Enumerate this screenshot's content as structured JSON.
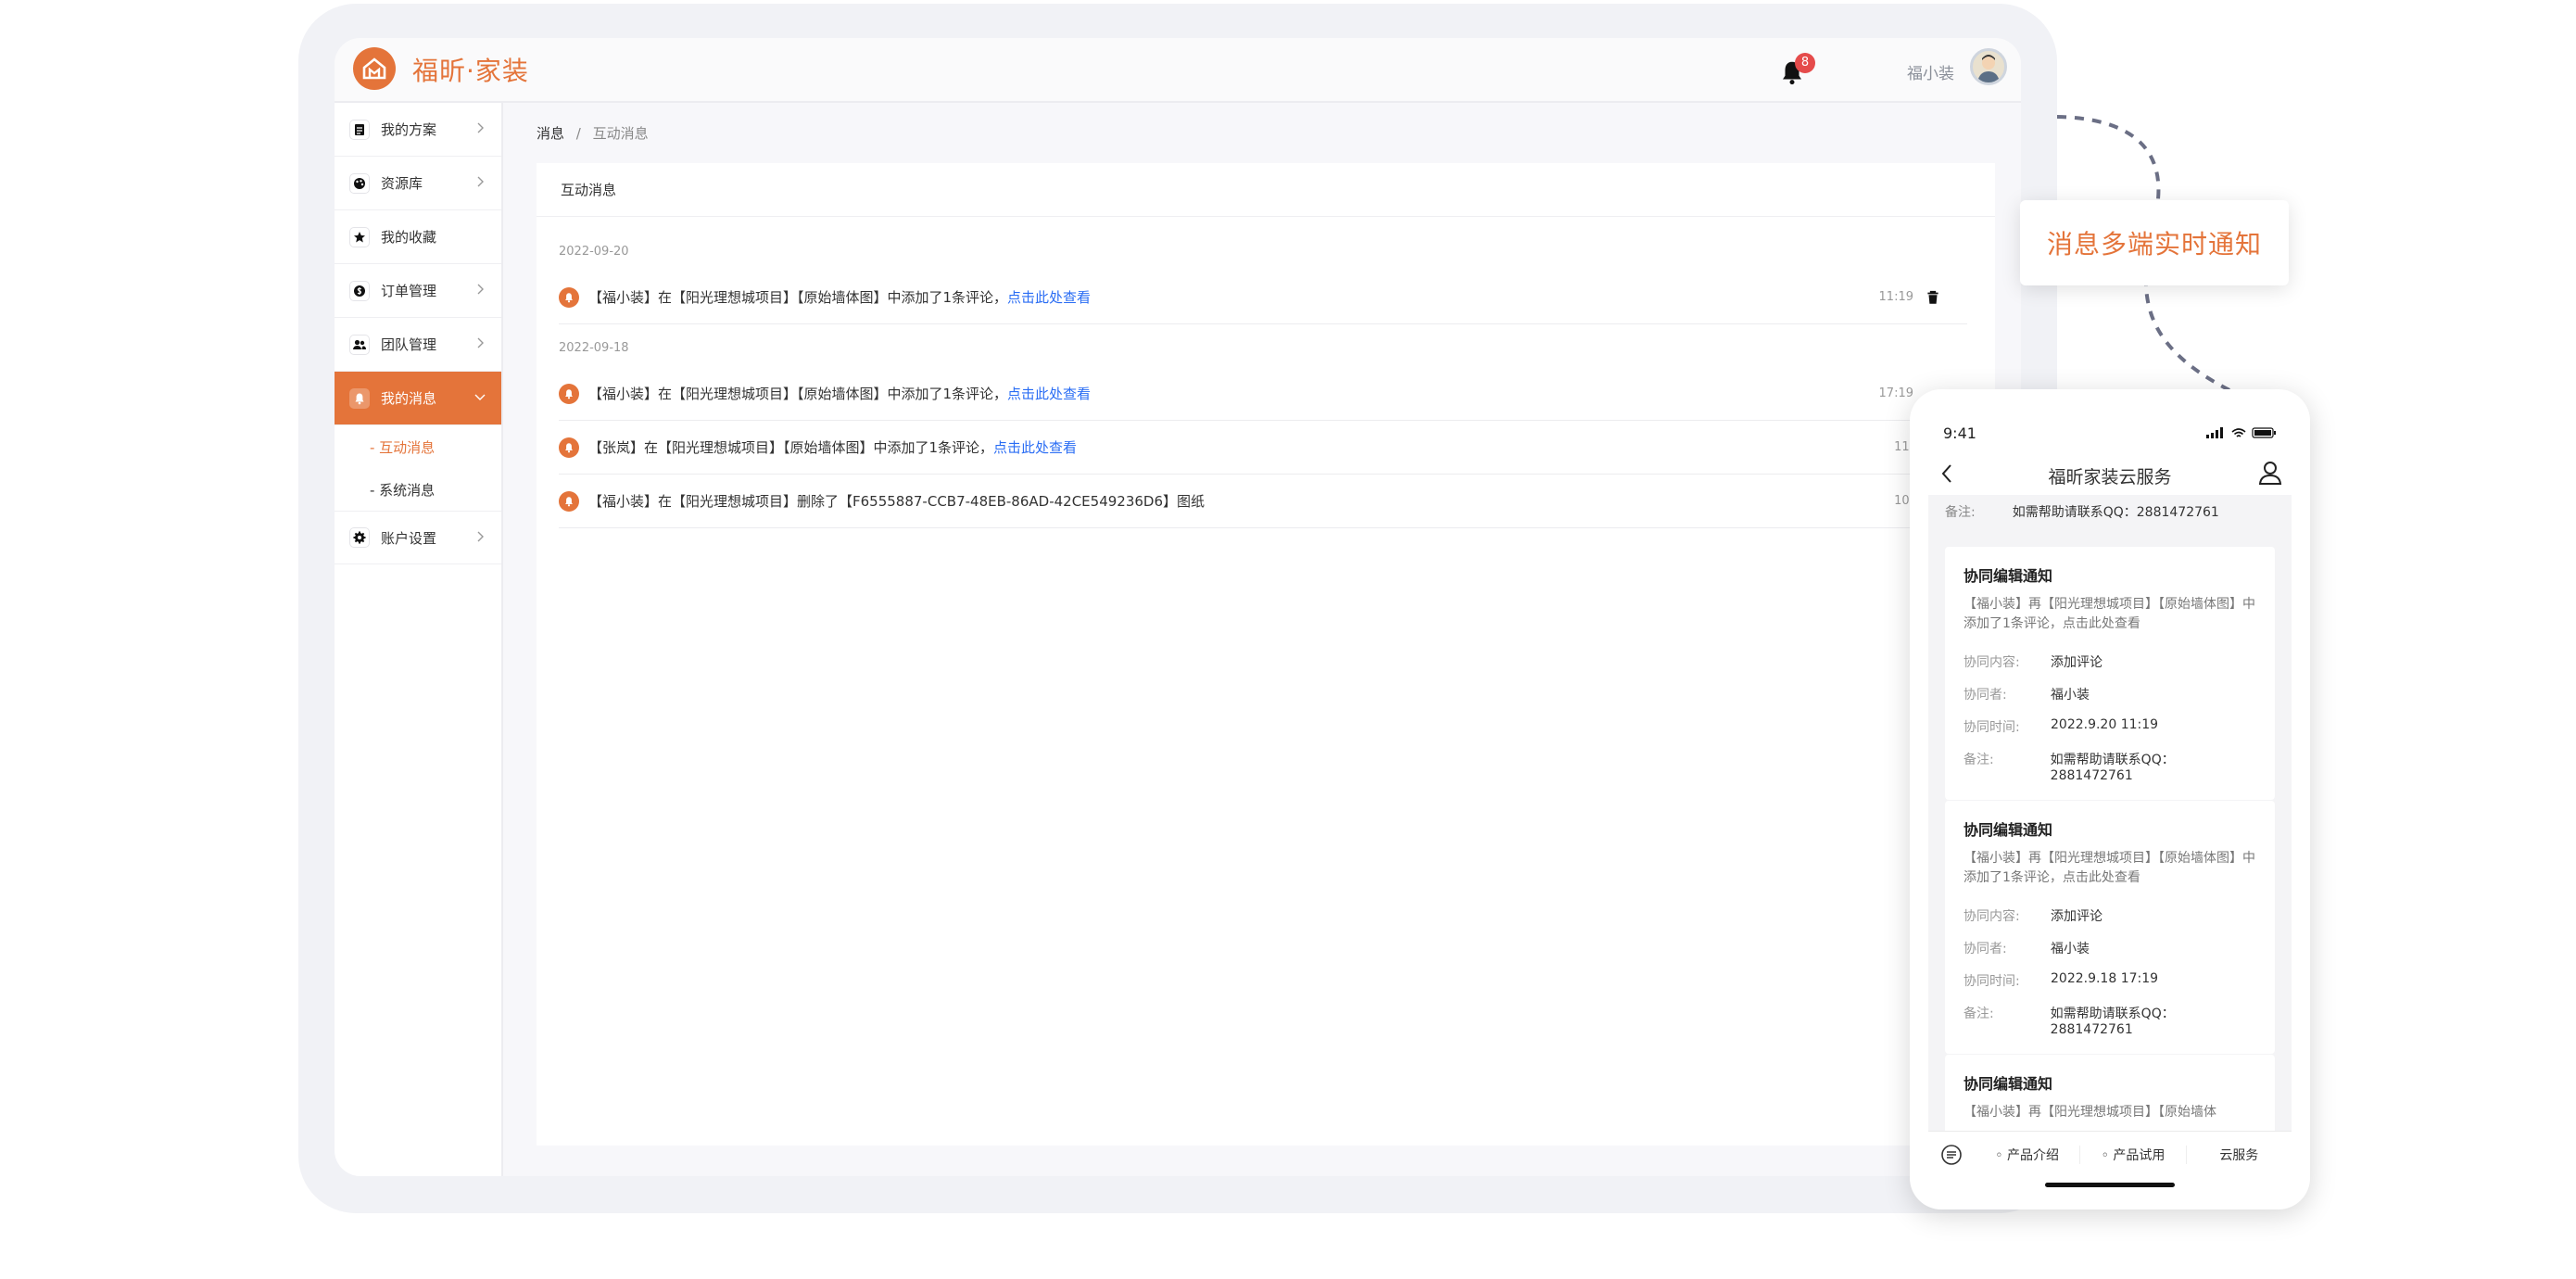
{
  "header": {
    "brand": "福昕·家装",
    "notification_count": "8",
    "username": "福小装"
  },
  "sidebar": {
    "items": [
      {
        "label": "我的方案",
        "icon": "document-icon"
      },
      {
        "label": "资源库",
        "icon": "palette-icon"
      },
      {
        "label": "我的收藏",
        "icon": "star-icon"
      },
      {
        "label": "订单管理",
        "icon": "dollar-icon"
      },
      {
        "label": "团队管理",
        "icon": "team-icon"
      },
      {
        "label": "我的消息",
        "icon": "bell-icon",
        "active": true
      },
      {
        "label": "账户设置",
        "icon": "gear-icon"
      }
    ],
    "sub_items": [
      "- 互动消息",
      "- 系统消息"
    ]
  },
  "breadcrumb": {
    "root": "消息",
    "sep": "/",
    "current": "互动消息"
  },
  "panel": {
    "title": "互动消息",
    "dates": [
      "2022-09-20",
      "2022-09-18"
    ],
    "messages": [
      {
        "text": "【福小装】在【阳光理想城项目】【原始墙体图】中添加了1条评论，",
        "link": "点击此处查看",
        "time": "11:19"
      },
      {
        "text": "【福小装】在【阳光理想城项目】【原始墙体图】中添加了1条评论，",
        "link": "点击此处查看",
        "time": "17:19"
      },
      {
        "text": "【张岚】在【阳光理想城项目】【原始墙体图】中添加了1条评论，",
        "link": "点击此处查看",
        "time": "11:"
      },
      {
        "text": "【福小装】在【阳光理想城项目】删除了【F6555887-CCB7-48EB-86AD-42CE549236D6】图纸",
        "link": "",
        "time": "10:"
      }
    ]
  },
  "callout": {
    "text": "消息多端实时通知"
  },
  "phone": {
    "time": "9:41",
    "title": "福昕家装云服务",
    "top_note_key": "备注:",
    "top_note_value": "如需帮助请联系QQ：2881472761",
    "cards": [
      {
        "title": "协同编辑通知",
        "desc": "【福小装】再【阳光理想城项目】【原始墙体图】中添加了1条评论，点击此处查看",
        "rows": [
          [
            "协同内容:",
            "添加评论"
          ],
          [
            "协同者:",
            "福小装"
          ],
          [
            "协同时间:",
            "2022.9.20  11:19"
          ],
          [
            "备注:",
            "如需帮助请联系QQ：2881472761"
          ]
        ]
      },
      {
        "title": "协同编辑通知",
        "desc": "【福小装】再【阳光理想城项目】【原始墙体图】中添加了1条评论，点击此处查看",
        "rows": [
          [
            "协同内容:",
            "添加评论"
          ],
          [
            "协同者:",
            "福小装"
          ],
          [
            "协同时间:",
            "2022.9.18  17:19"
          ],
          [
            "备注:",
            "如需帮助请联系QQ：2881472761"
          ]
        ]
      },
      {
        "title": "协同编辑通知",
        "desc": "【福小装】再【阳光理想城项目】【原始墙体"
      }
    ],
    "tabs": [
      "◦ 产品介绍",
      "◦ 产品试用",
      "云服务"
    ]
  },
  "colors": {
    "accent": "#e4743a",
    "link": "#2a6df4",
    "badge": "#e54b4b"
  }
}
